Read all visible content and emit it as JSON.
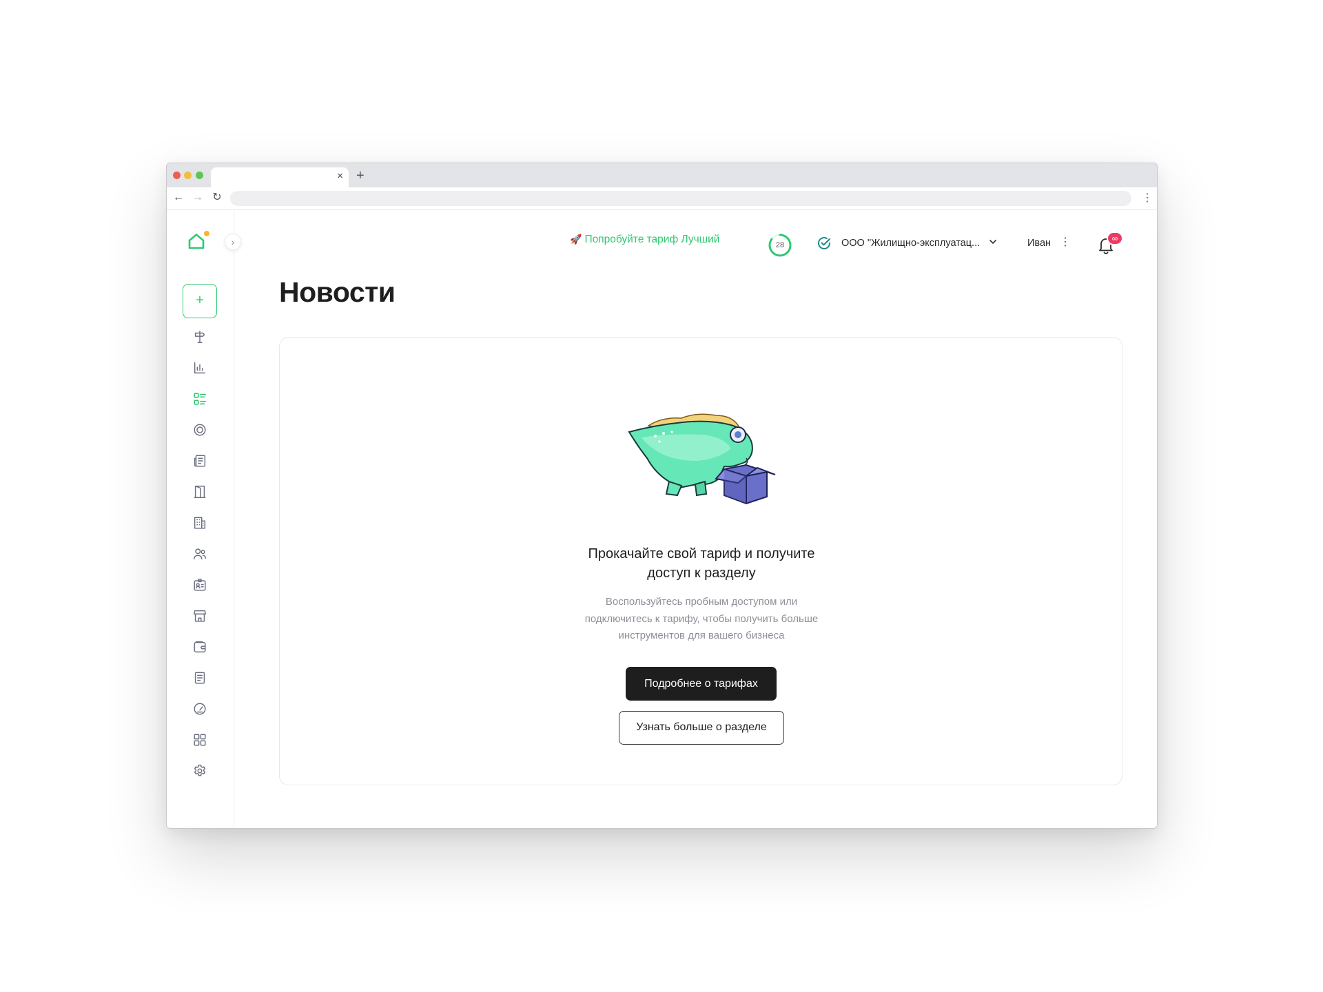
{
  "browser": {
    "tab_title": "",
    "tab_close": "×",
    "new_tab": "+",
    "back": "←",
    "forward": "→",
    "reload": "↻",
    "menu": "⋮",
    "url": ""
  },
  "sidebar": {
    "collapse_label": "›",
    "add_label": "+",
    "items": [
      {
        "icon": "signpost-icon"
      },
      {
        "icon": "bar-chart-icon"
      },
      {
        "icon": "news-list-icon",
        "active": true
      },
      {
        "icon": "target-icon"
      },
      {
        "icon": "newspaper-icon"
      },
      {
        "icon": "door-icon"
      },
      {
        "icon": "building-icon"
      },
      {
        "icon": "users-icon"
      },
      {
        "icon": "id-badge-icon"
      },
      {
        "icon": "store-icon"
      },
      {
        "icon": "wallet-icon"
      },
      {
        "icon": "document-icon"
      },
      {
        "icon": "gauge-icon"
      },
      {
        "icon": "apps-grid-icon"
      },
      {
        "icon": "settings-icon"
      }
    ]
  },
  "header": {
    "promo_rocket": "🚀",
    "promo_text": "Попробуйте тариф Лучший",
    "counter": "28",
    "counter_fraction": 0.85,
    "company": "ООО \"Жилищно-эксплуатац...",
    "user": "Иван",
    "user_menu": "⋮",
    "notifications_badge": "∞"
  },
  "page": {
    "title": "Новости"
  },
  "empty_state": {
    "title_line1": "Прокачайте свой тариф и получите",
    "title_line2": "доступ к разделу",
    "text_line1": "Воспользуйтесь пробным доступом или",
    "text_line2": "подключитесь к тарифу, чтобы получить больше",
    "text_line3": "инструментов для вашего бизнеса",
    "primary_button": "Подробнее о тарифах",
    "secondary_button": "Узнать больше о разделе"
  },
  "colors": {
    "accent": "#2ec971",
    "badge": "#ee3a62",
    "dark_button": "#1e1e1e",
    "muted_text": "#8f8f99"
  }
}
